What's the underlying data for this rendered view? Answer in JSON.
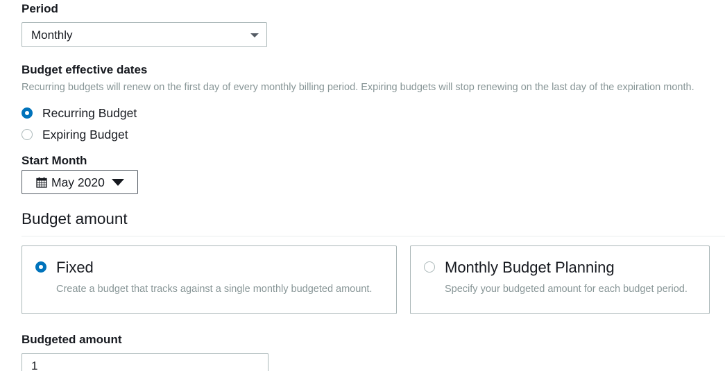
{
  "period": {
    "label": "Period",
    "selected": "Monthly"
  },
  "effective_dates": {
    "label": "Budget effective dates",
    "description": "Recurring budgets will renew on the first day of every monthly billing period. Expiring budgets will stop renewing on the last day of the expiration month.",
    "options": [
      {
        "label": "Recurring Budget",
        "selected": true
      },
      {
        "label": "Expiring Budget",
        "selected": false
      }
    ]
  },
  "start_month": {
    "label": "Start Month",
    "value": "May 2020",
    "icon": "calendar-icon"
  },
  "budget_amount": {
    "heading": "Budget amount",
    "tiles": [
      {
        "title": "Fixed",
        "description": "Create a budget that tracks against a single monthly budgeted amount.",
        "selected": true
      },
      {
        "title": "Monthly Budget Planning",
        "description": "Specify your budgeted amount for each budget period.",
        "selected": false
      }
    ]
  },
  "budgeted_amount": {
    "label": "Budgeted amount",
    "value": "1"
  },
  "colors": {
    "accent": "#0073bb",
    "border": "#aab7b8",
    "muted_text": "#879596",
    "text": "#16191f"
  }
}
